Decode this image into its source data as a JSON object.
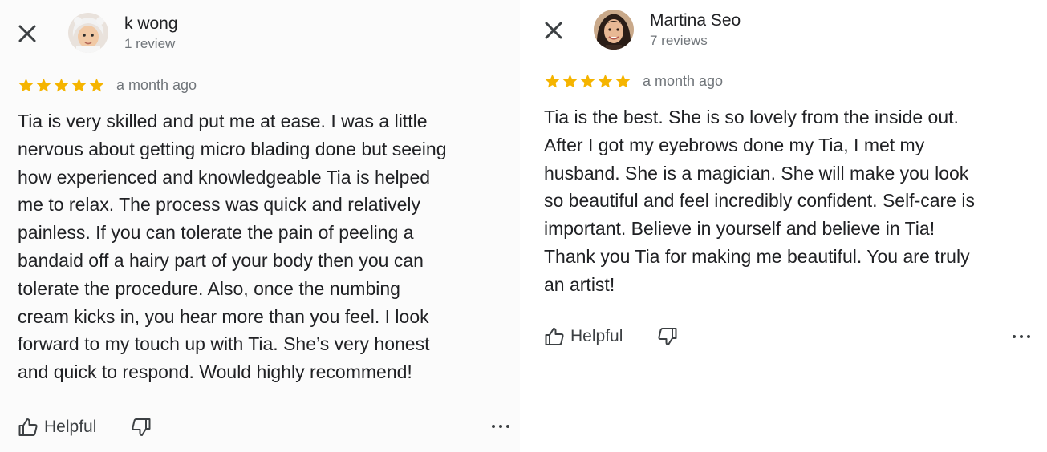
{
  "reviews": [
    {
      "reviewer_name": "k wong",
      "review_count": "1 review",
      "rating": 5,
      "date": "a month ago",
      "body_lines": [
        "Tia is very skilled and put me at ease.  I was a little",
        "nervous about getting micro blading done but seeing",
        "how experienced and knowledgeable Tia is helped",
        "me to relax. The process was quick and relatively",
        "painless. If you can tolerate the pain of peeling a",
        "bandaid off a hairy part of your body then you can",
        "tolerate the procedure. Also, once the numbing",
        "cream kicks in, you hear more than you feel. I look",
        "forward to my touch up with Tia. She’s very honest",
        "and quick to respond. Would highly recommend!"
      ],
      "helpful_label": "Helpful"
    },
    {
      "reviewer_name": "Martina Seo",
      "review_count": "7 reviews",
      "rating": 5,
      "date": "a month ago",
      "body_lines": [
        "Tia is the best. She is so lovely from the inside out.",
        "After I got my eyebrows done my Tia, I met my",
        "husband. She is a magician. She will make you look",
        "so beautiful and feel incredibly confident. Self-care is",
        "important. Believe in yourself and believe in Tia!",
        "Thank you Tia for making me beautiful. You are truly",
        "an artist!"
      ],
      "helpful_label": "Helpful"
    }
  ],
  "icons": {
    "close": "close-icon",
    "star": "star-icon",
    "thumb_up": "thumb-up-icon",
    "thumb_down": "thumb-down-icon",
    "more": "more-horizontal-icon"
  },
  "colors": {
    "star": "#f5b400",
    "text": "#202124",
    "secondary_text": "#70757a",
    "icon": "#3c4043"
  }
}
